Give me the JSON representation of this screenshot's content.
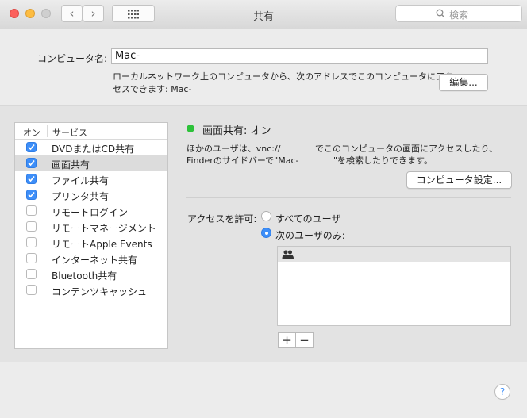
{
  "window": {
    "title": "共有",
    "back_glyph": "‹",
    "forward_glyph": "›",
    "grid_glyph": "⋮⋮⋮",
    "search_placeholder": "検索",
    "search_icon": "magnifier-icon",
    "colors": {
      "close": "#fc605c",
      "minimize": "#fdbc40",
      "zoom": "#cfcfcf"
    }
  },
  "computer_name": {
    "label": "コンピュータ名:",
    "value": "Mac-",
    "description_line1": "ローカルネットワーク上のコンピュータから、次のアドレスでこのコンピュータにアク",
    "description_line2": "セスできます: Mac-",
    "edit_button": "編集..."
  },
  "services": {
    "header_on": "オン",
    "header_service": "サービス",
    "items": [
      {
        "label": "DVDまたはCD共有",
        "checked": true,
        "selected": false
      },
      {
        "label": "画面共有",
        "checked": true,
        "selected": true
      },
      {
        "label": "ファイル共有",
        "checked": true,
        "selected": false
      },
      {
        "label": "プリンタ共有",
        "checked": true,
        "selected": false
      },
      {
        "label": "リモートログイン",
        "checked": false,
        "selected": false
      },
      {
        "label": "リモートマネージメント",
        "checked": false,
        "selected": false
      },
      {
        "label": "リモートApple Events",
        "checked": false,
        "selected": false
      },
      {
        "label": "インターネット共有",
        "checked": false,
        "selected": false
      },
      {
        "label": "Bluetooth共有",
        "checked": false,
        "selected": false
      },
      {
        "label": "コンテンツキャッシュ",
        "checked": false,
        "selected": false
      }
    ]
  },
  "detail": {
    "status_title": "画面共有: オン",
    "status_color": "#2dc23a",
    "desc_line1_a": "ほかのユーザは、vnc://",
    "desc_line1_b": "でこのコンピュータの画面にアクセスしたり、",
    "desc_line2_a": "Finderのサイドバーで\"Mac-",
    "desc_line2_b": "\"を検索したりできます。",
    "settings_button": "コンピュータ設定...",
    "access_label": "アクセスを許可:",
    "radio_all": "すべてのユーザ",
    "radio_only": "次のユーザのみ:",
    "user_icon": "group-icon",
    "add_button": "+",
    "remove_button": "−"
  },
  "help": {
    "glyph": "?"
  }
}
